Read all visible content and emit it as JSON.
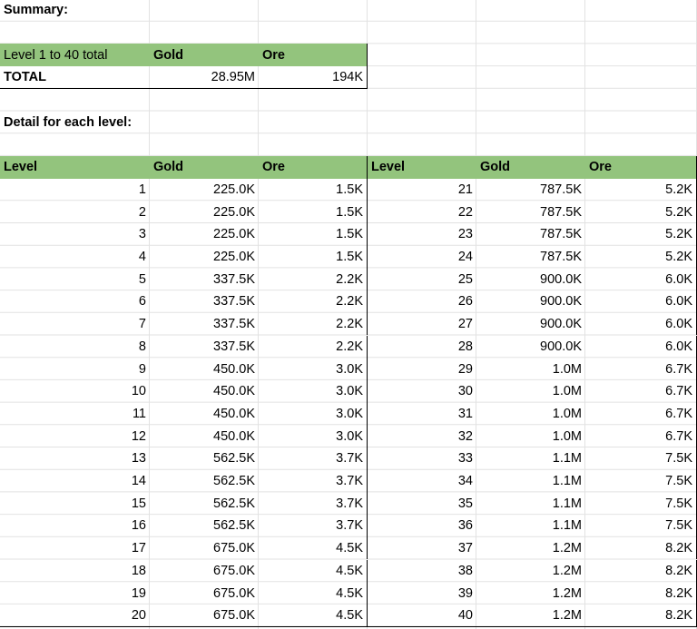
{
  "summary": {
    "heading": "Summary:",
    "header": [
      "Level 1 to 40 total",
      "Gold",
      "Ore"
    ],
    "total_row": [
      "TOTAL",
      "28.95M",
      "194K"
    ]
  },
  "detail_heading": "Detail for each level:",
  "detail": {
    "header": [
      "Level",
      "Gold",
      "Ore",
      "Level",
      "Gold",
      "Ore"
    ],
    "rows": [
      [
        "1",
        "225.0K",
        "1.5K",
        "21",
        "787.5K",
        "5.2K"
      ],
      [
        "2",
        "225.0K",
        "1.5K",
        "22",
        "787.5K",
        "5.2K"
      ],
      [
        "3",
        "225.0K",
        "1.5K",
        "23",
        "787.5K",
        "5.2K"
      ],
      [
        "4",
        "225.0K",
        "1.5K",
        "24",
        "787.5K",
        "5.2K"
      ],
      [
        "5",
        "337.5K",
        "2.2K",
        "25",
        "900.0K",
        "6.0K"
      ],
      [
        "6",
        "337.5K",
        "2.2K",
        "26",
        "900.0K",
        "6.0K"
      ],
      [
        "7",
        "337.5K",
        "2.2K",
        "27",
        "900.0K",
        "6.0K"
      ],
      [
        "8",
        "337.5K",
        "2.2K",
        "28",
        "900.0K",
        "6.0K"
      ],
      [
        "9",
        "450.0K",
        "3.0K",
        "29",
        "1.0M",
        "6.7K"
      ],
      [
        "10",
        "450.0K",
        "3.0K",
        "30",
        "1.0M",
        "6.7K"
      ],
      [
        "11",
        "450.0K",
        "3.0K",
        "31",
        "1.0M",
        "6.7K"
      ],
      [
        "12",
        "450.0K",
        "3.0K",
        "32",
        "1.0M",
        "6.7K"
      ],
      [
        "13",
        "562.5K",
        "3.7K",
        "33",
        "1.1M",
        "7.5K"
      ],
      [
        "14",
        "562.5K",
        "3.7K",
        "34",
        "1.1M",
        "7.5K"
      ],
      [
        "15",
        "562.5K",
        "3.7K",
        "35",
        "1.1M",
        "7.5K"
      ],
      [
        "16",
        "562.5K",
        "3.7K",
        "36",
        "1.1M",
        "7.5K"
      ],
      [
        "17",
        "675.0K",
        "4.5K",
        "37",
        "1.2M",
        "8.2K"
      ],
      [
        "18",
        "675.0K",
        "4.5K",
        "38",
        "1.2M",
        "8.2K"
      ],
      [
        "19",
        "675.0K",
        "4.5K",
        "39",
        "1.2M",
        "8.2K"
      ],
      [
        "20",
        "675.0K",
        "4.5K",
        "40",
        "1.2M",
        "8.2K"
      ]
    ]
  },
  "colors": {
    "header_fill": "#93c47d",
    "gridline": "#e2e2e2",
    "border": "#000000"
  }
}
